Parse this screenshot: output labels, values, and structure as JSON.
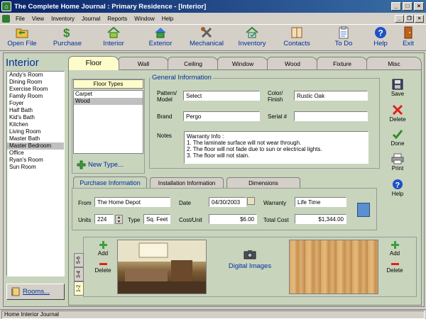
{
  "window": {
    "title": "The Complete Home Journal : Primary Residence - [Interior]"
  },
  "menu": [
    "File",
    "View",
    "Inventory",
    "Journal",
    "Reports",
    "Window",
    "Help"
  ],
  "toolbar": [
    {
      "label": "Open File",
      "icon": "open-file-icon"
    },
    {
      "label": "Purchase",
      "icon": "dollar-icon"
    },
    {
      "label": "Interior",
      "icon": "house-interior-icon"
    },
    {
      "label": "Exterior",
      "icon": "house-exterior-icon"
    },
    {
      "label": "Mechanical",
      "icon": "tools-icon"
    },
    {
      "label": "Inventory",
      "icon": "inventory-icon"
    },
    {
      "label": "Contacts",
      "icon": "address-book-icon"
    },
    {
      "label": "To Do",
      "icon": "clipboard-icon"
    },
    {
      "label": "Help",
      "icon": "help-icon"
    },
    {
      "label": "Exit",
      "icon": "exit-door-icon"
    }
  ],
  "left": {
    "title": "Interior",
    "rooms": [
      "Andy's Room",
      "Dining Room",
      "Exercise Room",
      "Family Room",
      "Foyer",
      "Half Bath",
      "Kid's Bath",
      "Kitchen",
      "Living Room",
      "Master Bath",
      "Master Bedroom",
      "Office",
      "Ryan's Room",
      "Sun Room"
    ],
    "selected_room": "Master Bedroom",
    "rooms_button": "Rooms..."
  },
  "tabs": [
    "Floor",
    "Wall",
    "Ceiling",
    "Window",
    "Wood",
    "Fixture",
    "Misc"
  ],
  "active_tab": "Floor",
  "floor_types": {
    "header": "Floor Types",
    "items": [
      "Carpet",
      "Wood"
    ],
    "selected": "Wood",
    "new_button": "New Type..."
  },
  "general": {
    "title": "General Information",
    "pattern_label": "Pattern/\nModel",
    "pattern_value": "Select",
    "color_label": "Color/\nFinish",
    "color_value": "Rustic Oak",
    "brand_label": "Brand",
    "brand_value": "Pergo",
    "serial_label": "Serial #",
    "serial_value": "",
    "notes_label": "Notes",
    "notes_lines": [
      "Warranty Info :",
      "1. The laminate surface will not wear through.",
      "2. The floor will not fade due to sun or electrical lights.",
      "3. The floor will not stain."
    ]
  },
  "actions": [
    "Save",
    "Delete",
    "Done",
    "Print",
    "Help"
  ],
  "subtabs": [
    "Purchase Information",
    "Installation Information",
    "Dimensions"
  ],
  "purchase": {
    "from_label": "From",
    "from_value": "The Home Depot",
    "date_label": "Date",
    "date_value": "04/30/2003",
    "warranty_label": "Warranty",
    "warranty_value": "Life Time",
    "units_label": "Units",
    "units_value": "224",
    "type_label": "Type",
    "type_value": "Sq. Feet",
    "cost_label": "Cost/Unit",
    "cost_value": "$6.00",
    "total_label": "Total Cost",
    "total_value": "$1,344.00"
  },
  "images": {
    "page_tabs": [
      "1-2",
      "3-4",
      "5-6"
    ],
    "active_page": "1-2",
    "add_label": "Add",
    "delete_label": "Delete",
    "digital_images_label": "Digital Images"
  },
  "statusbar": "Home Interior Journal",
  "colors": {
    "accent": "#00309c",
    "frame": "#c8d4bc",
    "tab_active": "#fffccc"
  }
}
